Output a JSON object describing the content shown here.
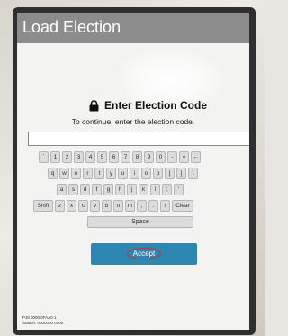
{
  "window": {
    "title": "Load Election"
  },
  "prompt": {
    "heading": "Enter Election Code",
    "lock_icon": "lock-icon",
    "instruction": "To continue, enter the election code."
  },
  "input": {
    "value": "",
    "placeholder": ""
  },
  "keyboard": {
    "row1": [
      "`",
      "1",
      "2",
      "3",
      "4",
      "5",
      "6",
      "7",
      "8",
      "9",
      "0",
      "-",
      "=",
      "←"
    ],
    "row2": [
      "q",
      "w",
      "e",
      "r",
      "t",
      "y",
      "u",
      "i",
      "o",
      "p",
      "[",
      "]",
      "\\"
    ],
    "row3": [
      "a",
      "s",
      "d",
      "f",
      "g",
      "h",
      "j",
      "k",
      "l",
      ";",
      "'"
    ],
    "row4": [
      "Shift",
      "z",
      "x",
      "c",
      "v",
      "b",
      "n",
      "m",
      ",",
      ".",
      "/",
      "Clear"
    ],
    "space_label": "Space"
  },
  "actions": {
    "accept_label": "Accept",
    "accept_color": "#2e86b3",
    "annotation_color": "#d62828"
  },
  "footer": {
    "line1": "PJ8 0000 0FAA0 1",
    "line2": "Station: 0000000 0000"
  }
}
